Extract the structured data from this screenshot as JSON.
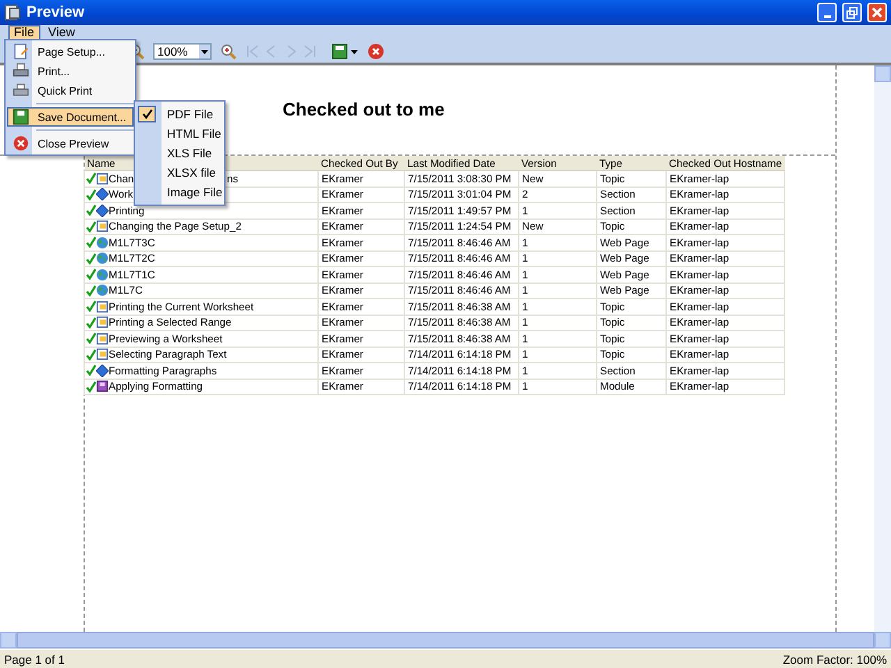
{
  "window": {
    "title": "Preview"
  },
  "menubar": [
    {
      "label": "File",
      "selected": true
    },
    {
      "label": "View",
      "selected": false
    }
  ],
  "toolbar": {
    "zoom_value": "100%"
  },
  "file_menu": [
    {
      "label": "Page Setup...",
      "kind": "item",
      "selected": false
    },
    {
      "label": "Print...",
      "kind": "item",
      "selected": false
    },
    {
      "label": "Quick Print",
      "kind": "item",
      "selected": false
    },
    {
      "kind": "separator"
    },
    {
      "label": "Save Document...",
      "kind": "submenu",
      "selected": true
    },
    {
      "kind": "separator"
    },
    {
      "label": "Close Preview",
      "kind": "item",
      "selected": false
    }
  ],
  "save_submenu": [
    {
      "label": "PDF File",
      "checked": true
    },
    {
      "label": "HTML File",
      "checked": false
    },
    {
      "label": "XLS File",
      "checked": false
    },
    {
      "label": "XLSX file",
      "checked": false
    },
    {
      "label": "Image File",
      "checked": false
    }
  ],
  "report": {
    "title": "Checked out to me",
    "columns": [
      "Name",
      "Checked Out By",
      "Last Modified Date",
      "Version",
      "Type",
      "Checked Out Hostname"
    ],
    "rows": [
      {
        "kind": "topic",
        "name": "Chan",
        "name_tail": "ns",
        "checked_out_by": "EKramer",
        "modified": "7/15/2011 3:08:30 PM",
        "version": "New",
        "type": "Topic",
        "host": "EKramer-lap"
      },
      {
        "kind": "section",
        "name": "Work",
        "checked_out_by": "EKramer",
        "modified": "7/15/2011 3:01:04 PM",
        "version": "2",
        "type": "Section",
        "host": "EKramer-lap"
      },
      {
        "kind": "section",
        "name": "Printing",
        "checked_out_by": "EKramer",
        "modified": "7/15/2011 1:49:57 PM",
        "version": "1",
        "type": "Section",
        "host": "EKramer-lap"
      },
      {
        "kind": "topic",
        "name": "Changing the Page Setup_2",
        "checked_out_by": "EKramer",
        "modified": "7/15/2011 1:24:54 PM",
        "version": "New",
        "type": "Topic",
        "host": "EKramer-lap"
      },
      {
        "kind": "web",
        "name": "M1L7T3C",
        "checked_out_by": "EKramer",
        "modified": "7/15/2011 8:46:46 AM",
        "version": "1",
        "type": "Web Page",
        "host": "EKramer-lap"
      },
      {
        "kind": "web",
        "name": "M1L7T2C",
        "checked_out_by": "EKramer",
        "modified": "7/15/2011 8:46:46 AM",
        "version": "1",
        "type": "Web Page",
        "host": "EKramer-lap"
      },
      {
        "kind": "web",
        "name": "M1L7T1C",
        "checked_out_by": "EKramer",
        "modified": "7/15/2011 8:46:46 AM",
        "version": "1",
        "type": "Web Page",
        "host": "EKramer-lap"
      },
      {
        "kind": "web",
        "name": "M1L7C",
        "checked_out_by": "EKramer",
        "modified": "7/15/2011 8:46:46 AM",
        "version": "1",
        "type": "Web Page",
        "host": "EKramer-lap"
      },
      {
        "kind": "topic",
        "name": "Printing the Current Worksheet",
        "checked_out_by": "EKramer",
        "modified": "7/15/2011 8:46:38 AM",
        "version": "1",
        "type": "Topic",
        "host": "EKramer-lap"
      },
      {
        "kind": "topic",
        "name": "Printing a Selected Range",
        "checked_out_by": "EKramer",
        "modified": "7/15/2011 8:46:38 AM",
        "version": "1",
        "type": "Topic",
        "host": "EKramer-lap"
      },
      {
        "kind": "topic",
        "name": "Previewing a Worksheet",
        "checked_out_by": "EKramer",
        "modified": "7/15/2011 8:46:38 AM",
        "version": "1",
        "type": "Topic",
        "host": "EKramer-lap"
      },
      {
        "kind": "topic",
        "name": "Selecting Paragraph Text",
        "checked_out_by": "EKramer",
        "modified": "7/14/2011 6:14:18 PM",
        "version": "1",
        "type": "Topic",
        "host": "EKramer-lap"
      },
      {
        "kind": "section",
        "name": "Formatting Paragraphs",
        "checked_out_by": "EKramer",
        "modified": "7/14/2011 6:14:18 PM",
        "version": "1",
        "type": "Section",
        "host": "EKramer-lap"
      },
      {
        "kind": "module",
        "name": "Applying Formatting",
        "checked_out_by": "EKramer",
        "modified": "7/14/2011 6:14:18 PM",
        "version": "1",
        "type": "Module",
        "host": "EKramer-lap"
      }
    ]
  },
  "status_bar": {
    "page": "Page 1 of 1",
    "zoom": "Zoom Factor: 100%"
  }
}
